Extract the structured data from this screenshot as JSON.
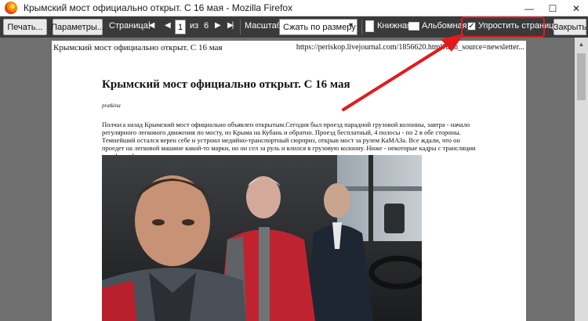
{
  "window": {
    "title": "Крымский мост официально открыт. С 16 мая - Mozilla Firefox"
  },
  "toolbar": {
    "print_label": "Печать...",
    "options_label": "Параметры...",
    "page_label": "Страница:",
    "current_page": "1",
    "of_label": "из",
    "total_pages": "6",
    "scale_label": "Масштаб:",
    "scale_value": "Сжать по размеру",
    "portrait_label": "Книжная",
    "landscape_label": "Альбомная",
    "simplify_label": "Упростить страницу",
    "simplify_checked": "✓",
    "close_label": "Закрыть"
  },
  "page": {
    "header_left": "Крымский мост официально открыт. С 16 мая",
    "header_right": "https://periskop.livejournal.com/1856620.html?utm_source=newsletter...",
    "title": "Крымский мост официально открыт. С 16 мая",
    "author": "pratkina",
    "body": "Полчаса назад Крымский мост официально объявлен открытым.Сегодня был проезд парадной грузовой колонны, завтра - начало регулярного легкового движения по мосту, из Крыма на Кубань и обратно. Проезд бесплатный, 4 полосы - по 2 в обе стороны. Темнейший остался верен себе и устроил медийно-транспортный сюрприз, открыв мост за рулем КаМАЗа. Все ждали, что он проедет на легковой машине какой-то марки, но он сел за руль и влился в грузовую колонну. Ниже - некоторые кадры с трансляции и инфографика про открытие движения для всех."
  },
  "colors": {
    "highlight": "#e11b1b",
    "toolbar_bg": "#3a3a3a",
    "preview_bg": "#6f6f6f"
  }
}
